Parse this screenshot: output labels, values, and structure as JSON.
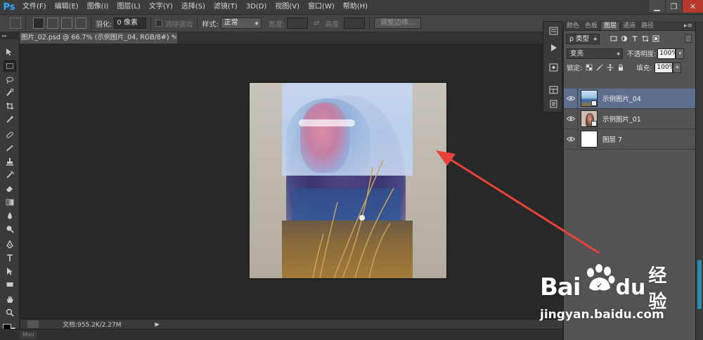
{
  "app": {
    "logo": "Ps"
  },
  "menu": [
    "文件(F)",
    "编辑(E)",
    "图像(I)",
    "图层(L)",
    "文字(Y)",
    "选择(S)",
    "滤镜(T)",
    "3D(D)",
    "视图(V)",
    "窗口(W)",
    "帮助(H)"
  ],
  "window_controls": {
    "minimize": "▁",
    "restore": "❐",
    "close": "✕"
  },
  "options": {
    "feather_label": "羽化:",
    "feather_value": "0 像素",
    "antialias_label": "消除锯齿",
    "style_label": "样式:",
    "style_value": "正常",
    "width_label": "宽度:",
    "height_label": "高度:",
    "swap_icon": "⇄",
    "refine_edge": "调整边缘..."
  },
  "document_tab": {
    "title": "图片_02.psd @ 66.7% (示例图片_04, RGB/8#) *",
    "close": "×"
  },
  "toolbar": {
    "header": "▸▸"
  },
  "status": {
    "doc_info": "文档:955.2K/2.27M",
    "arrow": "▶"
  },
  "bottom_tab": "Mini",
  "panel": {
    "tabs": [
      "颜色",
      "色板",
      "图层",
      "通道",
      "路径"
    ],
    "active_tab": "图层",
    "menu_icon": "▸≡",
    "filter_type": "ρ 类型",
    "blend_mode": "变亮",
    "opacity_label": "不透明度:",
    "opacity_value": "100%",
    "lock_label": "锁定:",
    "fill_label": "填充:",
    "fill_value": "100%",
    "dropdown": "▾",
    "layers": [
      {
        "name": "示例图片_04",
        "selected": true,
        "thumb": "sea",
        "smart": true
      },
      {
        "name": "示例图片_01",
        "selected": false,
        "thumb": "portrait",
        "smart": true
      },
      {
        "name": "图层 7",
        "selected": false,
        "thumb": "white",
        "smart": false
      }
    ]
  },
  "watermark": {
    "bai": "Bai",
    "du": "du",
    "jingyan": "经验",
    "url": "jingyan.baidu.com"
  },
  "colors": {
    "arrow": "#e8443a",
    "selection": "#5e6f8d",
    "accent": "#30a8ff"
  }
}
